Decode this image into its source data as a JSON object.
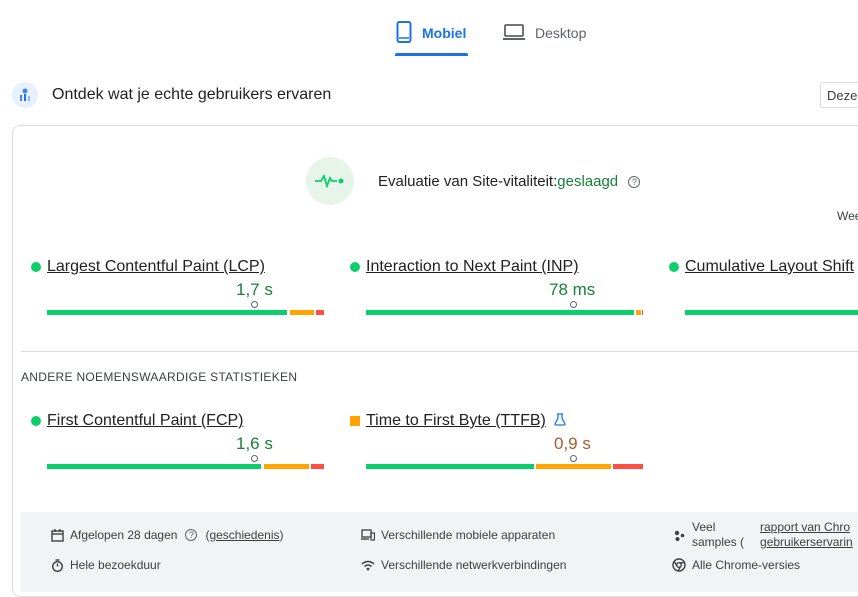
{
  "tabs": {
    "mobile": "Mobiel",
    "desktop": "Desktop"
  },
  "header": {
    "title": "Ontdek wat je echte gebruikers ervaren",
    "button": "Deze"
  },
  "assessment": {
    "label": "Evaluatie van Site-vitaliteit:",
    "result": "geslaagd",
    "cut_label": "Wee"
  },
  "core_metrics": [
    {
      "name": "Largest Contentful Paint (LCP)",
      "value": "1,7 s",
      "status": "good"
    },
    {
      "name": "Interaction to Next Paint (INP)",
      "value": "78 ms",
      "status": "good"
    },
    {
      "name": "Cumulative Layout Shift",
      "value": "",
      "status": "good"
    }
  ],
  "other_section_title": "ANDERE NOEMENSWAARDIGE STATISTIEKEN",
  "other_metrics": [
    {
      "name": "First Contentful Paint (FCP)",
      "value": "1,6 s",
      "status": "good"
    },
    {
      "name": "Time to First Byte (TTFB)",
      "value": "0,9 s",
      "status": "average"
    }
  ],
  "footer": {
    "period": "Afgelopen 28 dagen",
    "history_link": "geschiedenis",
    "devices": "Verschillende mobiele apparaten",
    "samples_line1": "Veel",
    "samples_line2": "samples (",
    "report_link_line1": "rapport van Chro",
    "report_link_line2": "gebruikerservarin",
    "duration": "Hele bezoekduur",
    "network": "Verschillende netwerkverbindingen",
    "chrome": "Alle Chrome-versies"
  },
  "colors": {
    "accent": "#1a73e8",
    "good": "#0cce6b",
    "average": "#ffa400",
    "poor": "#ff4e42",
    "pass_text": "#188038"
  }
}
